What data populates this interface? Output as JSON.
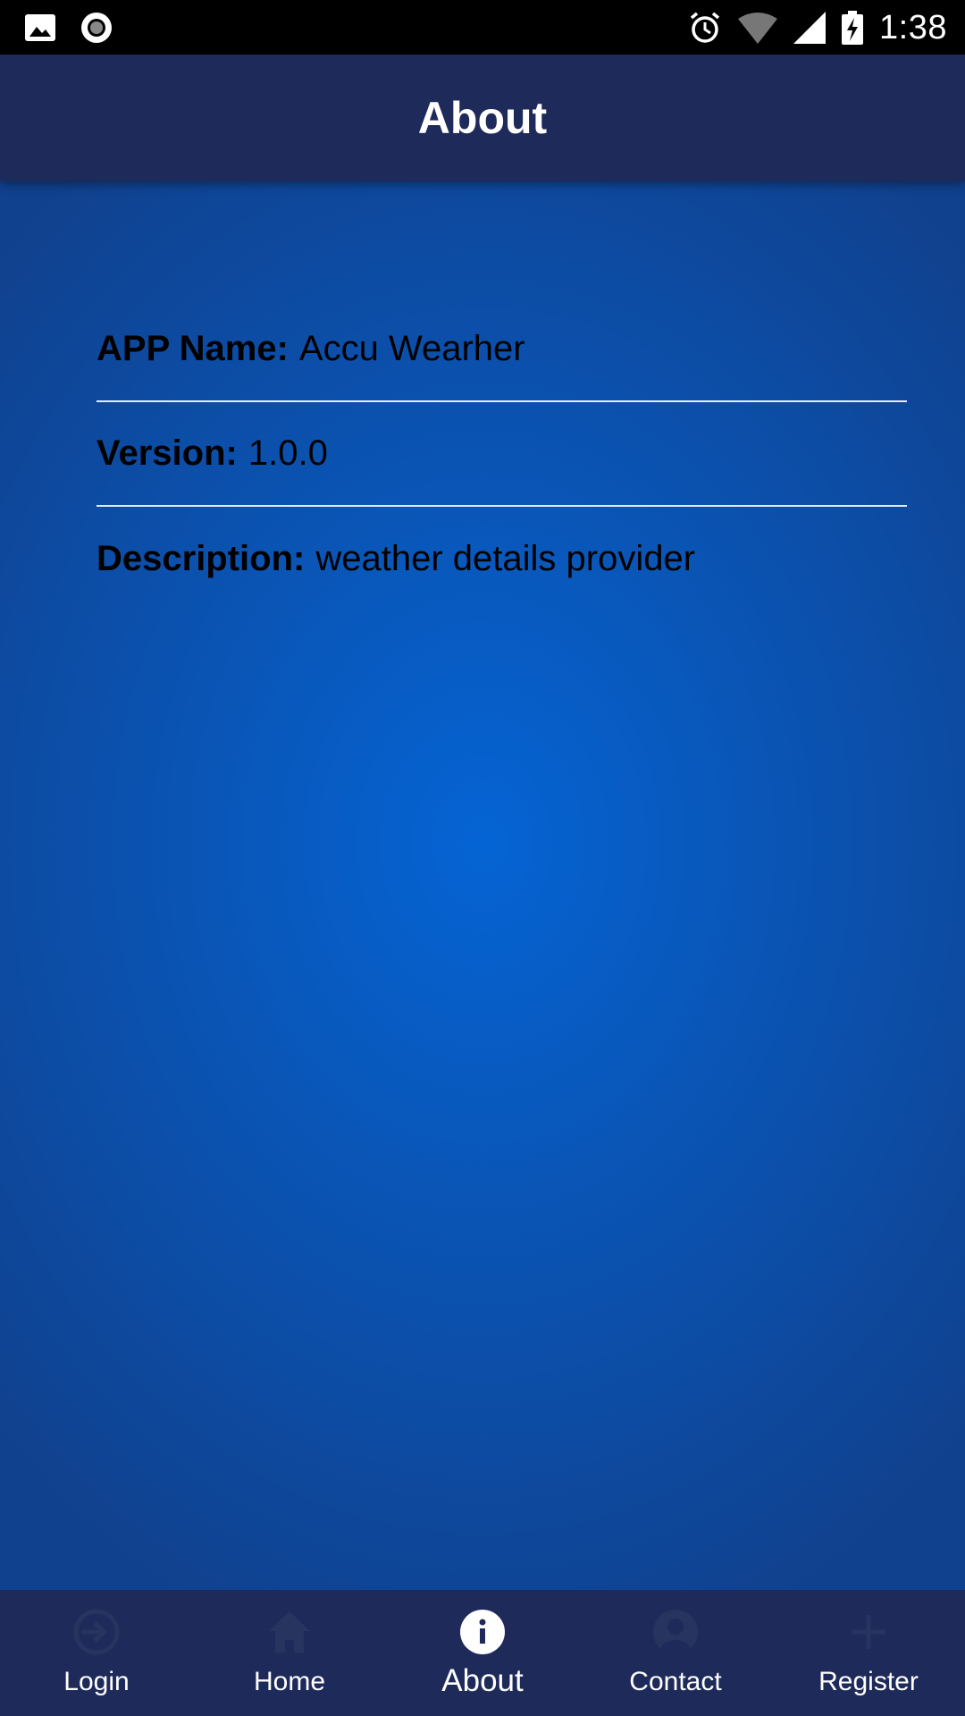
{
  "status_bar": {
    "time": "1:38",
    "left_icons": [
      "image-notification-icon",
      "record-notification-icon"
    ],
    "right_icons": [
      "alarm-icon",
      "wifi-icon",
      "cell-signal-icon",
      "battery-charging-icon"
    ]
  },
  "app_bar": {
    "title": "About"
  },
  "about": {
    "app_name_label": "APP Name:",
    "app_name_value": "Accu Wearher",
    "version_label": "Version:",
    "version_value": "1.0.0",
    "description_label": "Description:",
    "description_value": "weather details provider"
  },
  "bottom_nav": {
    "items": [
      {
        "label": "Login",
        "icon": "login-icon",
        "active": false
      },
      {
        "label": "Home",
        "icon": "home-icon",
        "active": false
      },
      {
        "label": "About",
        "icon": "info-icon",
        "active": true
      },
      {
        "label": "Contact",
        "icon": "account-circle-icon",
        "active": false
      },
      {
        "label": "Register",
        "icon": "plus-icon",
        "active": false
      }
    ]
  },
  "colors": {
    "app_bar": "#1e2a5a",
    "content_center": "#0564d4",
    "content_edge": "#10418e",
    "divider": "#e8ecf4",
    "inactive_icon": "#27345f",
    "active_icon": "#ffffff"
  }
}
